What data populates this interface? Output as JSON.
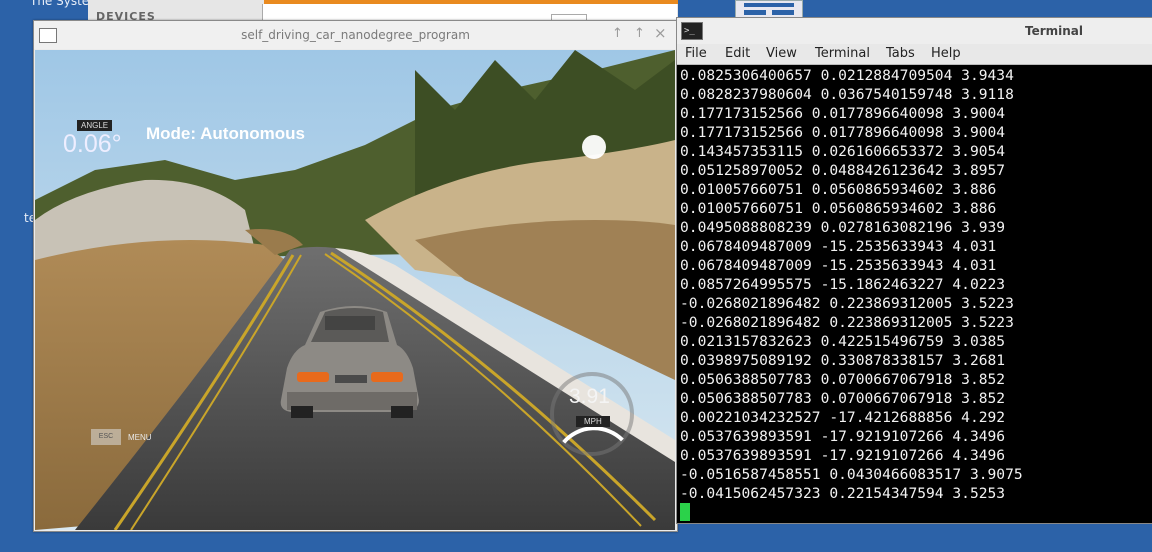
{
  "desktop": {
    "top_left_text": "The Syste",
    "side_text": "te"
  },
  "file_manager": {
    "sidebar_heading": "DEVICES"
  },
  "simulator": {
    "window_title": "self_driving_car_nanodegree_program",
    "controls": {
      "maximize": "↑",
      "restore": "↑",
      "close": "×"
    },
    "hud": {
      "angle_label": "ANGLE",
      "angle_value": "0.06°",
      "mode": "Mode: Autonomous",
      "speed_value": "3.91",
      "speed_unit": "MPH",
      "menu_button": "ESC",
      "menu_label": "MENU",
      "speed_gauge_fraction": 0.35
    }
  },
  "terminal": {
    "window_title": "Terminal",
    "menu": [
      "File",
      "Edit",
      "View",
      "Terminal",
      "Tabs",
      "Help"
    ],
    "lines": [
      "0.0825306400657 0.0212884709504 3.9434",
      "0.0828237980604 0.0367540159748 3.9118",
      "0.177173152566 0.0177896640098 3.9004",
      "0.177173152566 0.0177896640098 3.9004",
      "0.143457353115 0.0261606653372 3.9054",
      "0.051258970052 0.0488426123642 3.8957",
      "0.010057660751 0.0560865934602 3.886",
      "0.010057660751 0.0560865934602 3.886",
      "0.0495088808239 0.0278163082196 3.939",
      "0.0678409487009 -15.2535633943 4.031",
      "0.0678409487009 -15.2535633943 4.031",
      "0.0857264995575 -15.1862463227 4.0223",
      "-0.0268021896482 0.223869312005 3.5223",
      "-0.0268021896482 0.223869312005 3.5223",
      "0.0213157832623 0.422515496759 3.0385",
      "0.0398975089192 0.330878338157 3.2681",
      "0.0506388507783 0.0700667067918 3.852",
      "0.0506388507783 0.0700667067918 3.852",
      "0.00221034232527 -17.4212688856 4.292",
      "0.0537639893591 -17.9219107266 4.3496",
      "0.0537639893591 -17.9219107266 4.3496",
      "-0.0516587458551 0.0430466083517 3.9075",
      "-0.0415062457323 0.22154347594 3.5253"
    ]
  }
}
